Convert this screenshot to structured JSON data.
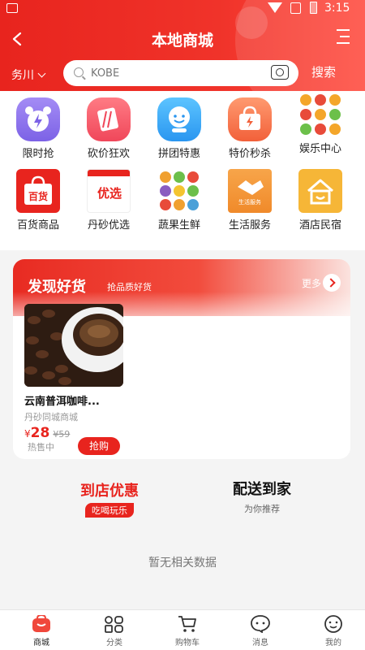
{
  "status_bar": {
    "time": "3:15"
  },
  "header": {
    "title": "本地商城",
    "location": "务川",
    "search_placeholder": "KOBE",
    "search_button": "搜索"
  },
  "categories": [
    {
      "label": "限时抢",
      "icon": "alarm-clock-icon"
    },
    {
      "label": "砍价狂欢",
      "icon": "bargain-icon"
    },
    {
      "label": "拼团特惠",
      "icon": "group-buy-icon"
    },
    {
      "label": "特价秒杀",
      "icon": "flash-sale-icon"
    },
    {
      "label": "娱乐中心",
      "icon": "entertainment-icon"
    },
    {
      "label": "百货商品",
      "icon": "department-store-icon",
      "badge": "百货"
    },
    {
      "label": "丹砂优选",
      "icon": "preferred-icon",
      "badge": "优选"
    },
    {
      "label": "蔬果生鲜",
      "icon": "fruit-vegetable-icon"
    },
    {
      "label": "生活服务",
      "icon": "life-service-icon",
      "badge": "生活服务"
    },
    {
      "label": "酒店民宿",
      "icon": "hotel-icon"
    }
  ],
  "discover": {
    "title": "发现好货",
    "subtitle": "抢品质好货",
    "more": "更多",
    "product": {
      "name": "云南普洱咖啡...",
      "store": "丹砂同城商城",
      "currency": "¥",
      "price": "28",
      "old_price": "¥59",
      "status": "热售中",
      "buy_label": "抢购"
    }
  },
  "promo": {
    "left_title": "到店优惠",
    "left_tag": "吃喝玩乐",
    "right_title": "配送到家",
    "right_sub": "为你推荐"
  },
  "empty_text": "暂无相关数据",
  "bottom_nav": [
    {
      "label": "商城",
      "icon": "mall-icon",
      "active": true
    },
    {
      "label": "分类",
      "icon": "category-icon",
      "active": false
    },
    {
      "label": "购物车",
      "icon": "cart-icon",
      "active": false
    },
    {
      "label": "消息",
      "icon": "message-icon",
      "active": false
    },
    {
      "label": "我的",
      "icon": "profile-icon",
      "active": false
    }
  ],
  "colors": {
    "accent": "#e8241e"
  }
}
